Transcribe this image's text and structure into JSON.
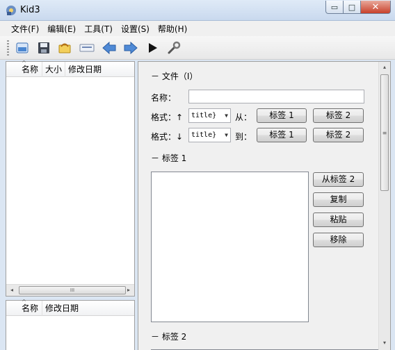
{
  "window": {
    "title": "Kid3",
    "minimize_label": "▭",
    "maximize_label": "□",
    "close_label": "✕"
  },
  "menu": [
    {
      "label": "文件(F)"
    },
    {
      "label": "编辑(E)"
    },
    {
      "label": "工具(T)"
    },
    {
      "label": "设置(S)"
    },
    {
      "label": "帮助(H)"
    }
  ],
  "toolbar": {
    "icons": [
      "open-folder-icon",
      "save-icon",
      "revert-icon",
      "rename-icon",
      "previous-file-icon",
      "next-file-icon",
      "play-icon",
      "settings-wrench-icon"
    ]
  },
  "file_list": {
    "columns": [
      "名称",
      "大小",
      "修改日期"
    ],
    "hscroll_thumb": "III",
    "arrow_left": "◂",
    "arrow_right": "▸"
  },
  "dir_list": {
    "columns": [
      "名称",
      "修改日期"
    ]
  },
  "file_section": {
    "title": "－ 文件（I）",
    "name_label": "名称：",
    "name_value": "",
    "format_up_label": "格式：↑",
    "format_up_value": "title}",
    "from_label": "从：",
    "from_tag1_button": "标签 1",
    "from_tag2_button": "标签 2",
    "format_down_label": "格式：↓",
    "format_down_value": "title}",
    "to_label": "到：",
    "to_tag1_button": "标签 1",
    "to_tag2_button": "标签 2"
  },
  "tag1_section": {
    "title": "－ 标签 1",
    "from_tag2_button": "从标签 2",
    "copy_button": "复制",
    "paste_button": "粘贴",
    "remove_button": "移除"
  },
  "tag2_section": {
    "title": "－ 标签 2"
  },
  "right_scroll": {
    "thumb": "≡",
    "arrow_up": "▴",
    "arrow_down": "▾"
  }
}
